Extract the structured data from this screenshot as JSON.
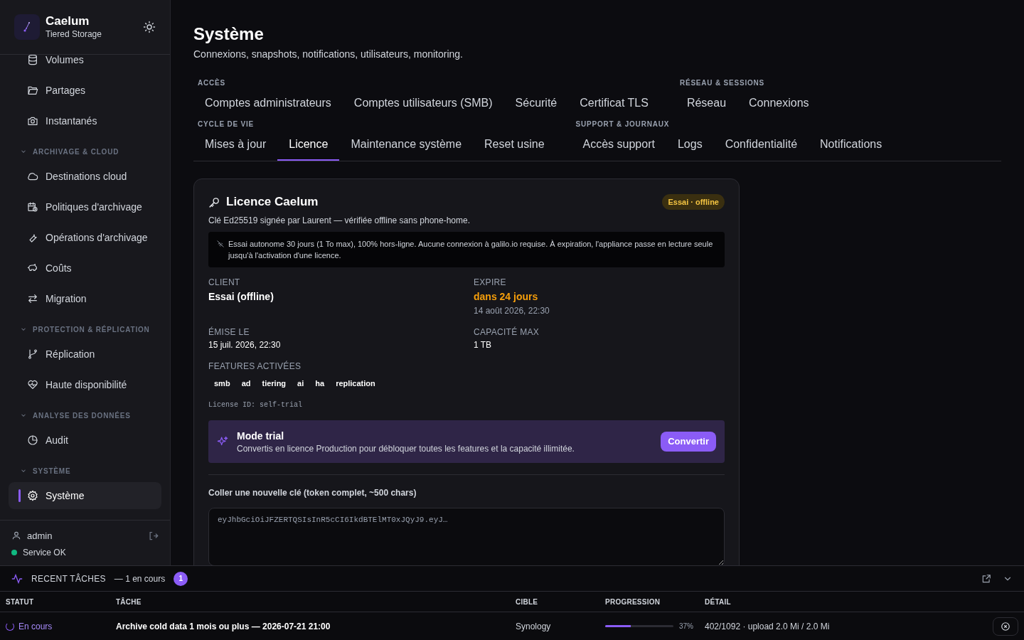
{
  "brand": {
    "name": "Caelum",
    "subtitle": "Tiered Storage"
  },
  "sidebar": {
    "sections": [
      {
        "items": [
          {
            "label": "Volumes",
            "selected": false
          },
          {
            "label": "Partages",
            "selected": false
          },
          {
            "label": "Instantanés",
            "selected": false
          }
        ]
      },
      {
        "title": "ARCHIVAGE & CLOUD",
        "expanded": true,
        "items": [
          {
            "label": "Destinations cloud",
            "selected": false
          },
          {
            "label": "Politiques d'archivage",
            "selected": false
          },
          {
            "label": "Opérations d'archivage",
            "selected": false
          },
          {
            "label": "Coûts",
            "selected": false
          },
          {
            "label": "Migration",
            "selected": false
          }
        ]
      },
      {
        "title": "PROTECTION & RÉPLICATION",
        "expanded": true,
        "items": [
          {
            "label": "Réplication",
            "selected": false
          },
          {
            "label": "Haute disponibilité",
            "selected": false
          }
        ]
      },
      {
        "title": "ANALYSE DES DONNÉES",
        "expanded": true,
        "items": [
          {
            "label": "Audit",
            "selected": false
          }
        ]
      },
      {
        "title": "SYSTÈME",
        "expanded": true,
        "items": [
          {
            "label": "Système",
            "selected": true
          }
        ]
      }
    ],
    "user": "admin",
    "service": {
      "label": "Service OK",
      "color": "#10b981"
    }
  },
  "page": {
    "title": "Système",
    "subtitle": "Connexions, snapshots, notifications, utilisateurs, monitoring."
  },
  "tab_groups": [
    {
      "label": "ACCÈS",
      "tabs": [
        {
          "label": "Comptes administrateurs",
          "selected": false
        },
        {
          "label": "Comptes utilisateurs (SMB)",
          "selected": false
        },
        {
          "label": "Sécurité",
          "selected": false
        },
        {
          "label": "Certificat TLS",
          "selected": false
        }
      ]
    },
    {
      "label": "RÉSEAU & SESSIONS",
      "tabs": [
        {
          "label": "Réseau",
          "selected": false
        },
        {
          "label": "Connexions",
          "selected": false
        }
      ]
    },
    {
      "label": "CYCLE DE VIE",
      "tabs": [
        {
          "label": "Mises à jour",
          "selected": false
        },
        {
          "label": "Licence",
          "selected": true
        },
        {
          "label": "Maintenance système",
          "selected": false
        },
        {
          "label": "Reset usine",
          "selected": false
        }
      ]
    },
    {
      "label": "SUPPORT & JOURNAUX",
      "tabs": [
        {
          "label": "Accès support",
          "selected": false
        },
        {
          "label": "Logs",
          "selected": false
        },
        {
          "label": "Confidentialité",
          "selected": false
        },
        {
          "label": "Notifications",
          "selected": false
        }
      ]
    }
  ],
  "license_card": {
    "title": "Licence Caelum",
    "badge": "Essai · offline",
    "subtitle": "Clé Ed25519 signée par Laurent — vérifiée offline sans phone-home.",
    "notice": "Essai autonome 30 jours (1 To max), 100% hors-ligne. Aucune connexion à galilo.io requise. À expiration, l'appliance passe en lecture seule jusqu'à l'activation d'une licence.",
    "fields": [
      {
        "label": "CLIENT",
        "value": "Essai (offline)",
        "kind": "strong"
      },
      {
        "label": "EXPIRE",
        "value": "dans 24 jours",
        "sub": "14 août 2026, 22:30",
        "kind": "warning"
      },
      {
        "label": "ÉMISE LE",
        "value": "15 juil. 2026, 22:30",
        "kind": "plain"
      },
      {
        "label": "CAPACITÉ MAX",
        "value": "1 TB",
        "kind": "plain"
      }
    ],
    "features_label": "FEATURES ACTIVÉES",
    "features": [
      "smb",
      "ad",
      "tiering",
      "ai",
      "ha",
      "replication"
    ],
    "license_id": "License ID: self-trial",
    "trial": {
      "title": "Mode trial",
      "text": "Convertis en licence Production pour débloquer toutes les features et la capacité illimitée.",
      "button": "Convertir"
    },
    "key_label": "Coller une nouvelle clé (token complet, ~500 chars)",
    "key_placeholder": "eyJhbGciOiJFZERTQSIsInR5cCI6IkdBTElMT0xJQyJ9.eyJ…"
  },
  "tasks_panel": {
    "title": "RECENT TÂCHES",
    "summary": "— 1 en cours",
    "count": "1",
    "columns": [
      "STATUT",
      "TÂCHE",
      "CIBLE",
      "PROGRESSION",
      "DÉTAIL"
    ],
    "rows": [
      {
        "status": "En cours",
        "task": "Archive cold data 1 mois ou plus — 2026-07-21 21:00",
        "target": "Synology",
        "level": 0.37,
        "percent": "37%",
        "detail": "402/1092 · upload 2.0 Mi / 2.0 Mi"
      }
    ]
  }
}
